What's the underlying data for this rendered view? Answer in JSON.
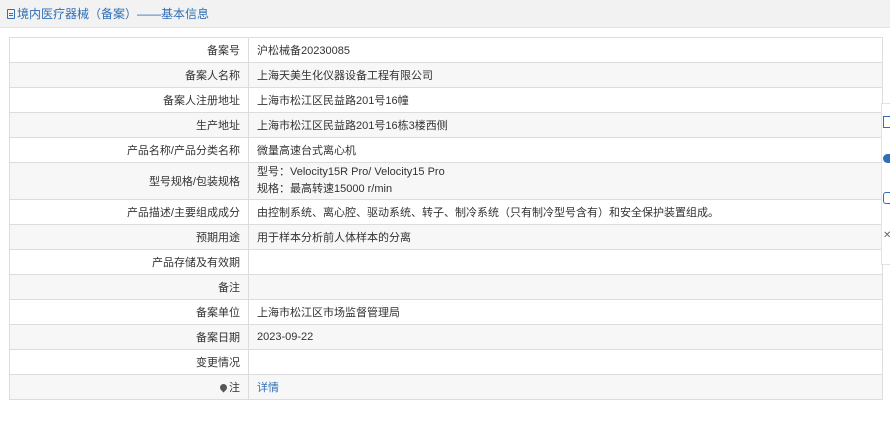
{
  "header": {
    "title": "境内医疗器械（备案）——基本信息"
  },
  "rows": [
    {
      "label": "备案号",
      "value": "沪松械备20230085"
    },
    {
      "label": "备案人名称",
      "value": "上海天美生化仪器设备工程有限公司"
    },
    {
      "label": "备案人注册地址",
      "value": "上海市松江区民益路201号16幢"
    },
    {
      "label": "生产地址",
      "value": "上海市松江区民益路201号16栋3楼西侧"
    },
    {
      "label": "产品名称/产品分类名称",
      "value": "微量高速台式离心机"
    },
    {
      "label": "型号规格/包装规格",
      "value_line1": "型号：Velocity15R Pro/ Velocity15 Pro",
      "value_line2": "规格：最高转速15000 r/min"
    },
    {
      "label": "产品描述/主要组成成分",
      "value": "由控制系统、离心腔、驱动系统、转子、制冷系统（只有制冷型号含有）和安全保护装置组成。"
    },
    {
      "label": "预期用途",
      "value": "用于样本分析前人体样本的分离"
    },
    {
      "label": "产品存储及有效期",
      "value": ""
    },
    {
      "label": "备注",
      "value": ""
    },
    {
      "label": "备案单位",
      "value": "上海市松江区市场监督管理局"
    },
    {
      "label": "备案日期",
      "value": "2023-09-22"
    },
    {
      "label": "变更情况",
      "value": ""
    },
    {
      "label": "注",
      "value": "详情"
    }
  ],
  "side_toolbar": {
    "close_glyph": "✕"
  },
  "colors": {
    "accent": "#2f6fb5",
    "border": "#dcdcdc",
    "stripe": "#f7f7f7",
    "header_bg": "#f2f2f2"
  }
}
